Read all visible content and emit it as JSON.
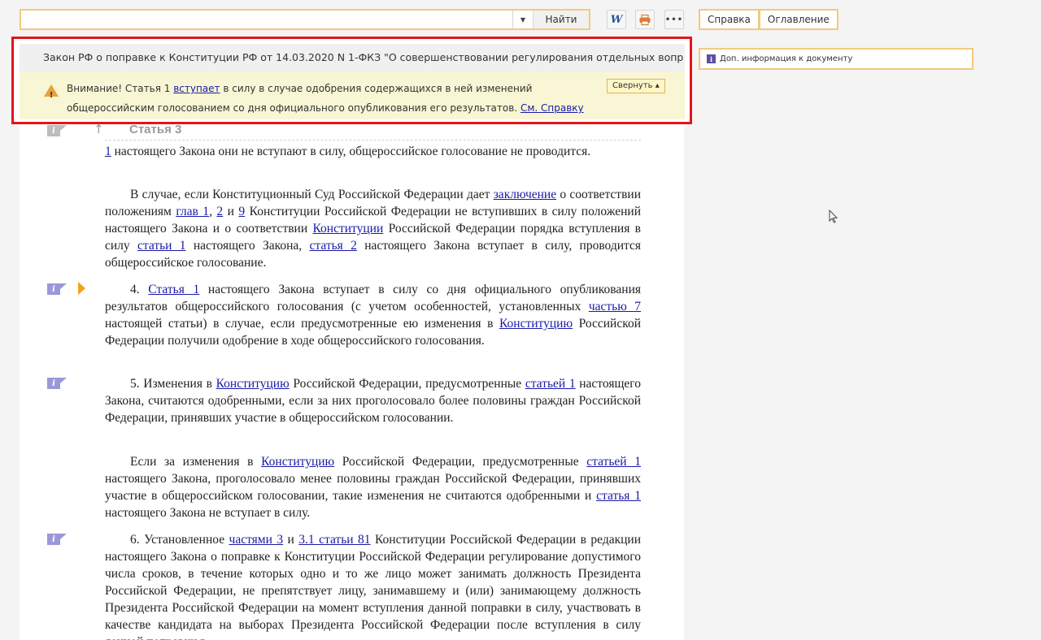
{
  "toolbar": {
    "search_value": "",
    "search_button": "Найти",
    "word_icon_glyph": "W",
    "more_glyph": "•••"
  },
  "right_panel": {
    "tabs": [
      "Справка",
      "Оглавление"
    ],
    "doc_info_icon": "i",
    "doc_info_label": "Доп. информация к документу"
  },
  "banner": {
    "title": "Закон РФ о поправке к Конституции РФ от 14.03.2020 N 1-ФКЗ \"О совершенствовании регулирования отдельных вопр",
    "warning_prefix": "Внимание! Статья 1 ",
    "warning_link": "вступает",
    "warning_mid": " в силу в случае одобрения содержащихся в ней изменений",
    "warning_line2": "общероссийским голосованием со дня официального опубликования его результатов. ",
    "warning_link2": "См. Справку",
    "collapse_label": "Свернуть ▴"
  },
  "article": {
    "heading": "Статья 3",
    "up_arrow": "↑",
    "margin_icon": "i",
    "p0": {
      "link": "1",
      "text": " настоящего Закона они не вступают в силу, общероссийское голосование не проводится."
    },
    "p1": {
      "t1": "В случае, если Конституционный Суд Российской Федерации дает ",
      "l1": "заключение",
      "t2": " о соответствии положениям ",
      "l2": "глав 1",
      "t3": ", ",
      "l3": "2",
      "t4": " и ",
      "l4": "9",
      "t5": " Конституции Российской Федерации не вступивших в силу положений настоящего Закона и о соответствии ",
      "l5": "Конституции",
      "t6": " Российской Федерации порядка вступления в силу ",
      "l6": "статьи 1",
      "t7": " настоящего Закона, ",
      "l7": "статья 2",
      "t8": " настоящего Закона вступает в силу, проводится общероссийское голосование."
    },
    "p2": {
      "t1": "4. ",
      "l1": "Статья 1",
      "t2": " настоящего Закона вступает в силу со дня официального опубликования результатов общероссийского голосования (с учетом особенностей, установленных ",
      "l2": "частью 7",
      "t3": " настоящей статьи) в случае, если предусмотренные ею изменения в ",
      "l3": "Конституцию",
      "t4": " Российской Федерации получили одобрение в ходе общероссийского голосования."
    },
    "p3": {
      "t1": "5. Изменения в ",
      "l1": "Конституцию",
      "t2": " Российской Федерации, предусмотренные ",
      "l2": "статьей 1",
      "t3": " настоящего Закона, считаются одобренными, если за них проголосовало более половины граждан Российской Федерации, принявших участие в общероссийском голосовании."
    },
    "p4": {
      "t1": "Если за изменения в ",
      "l1": "Конституцию",
      "t2": " Российской Федерации, предусмотренные ",
      "l2": "статьей 1",
      "t3": " настоящего Закона, проголосовало менее половины граждан Российской Федерации, принявших участие в общероссийском голосовании, такие изменения не считаются одобренными и ",
      "l3": "статья 1",
      "t4": " настоящего Закона не вступает в силу."
    },
    "p5": {
      "t1": "6. Установленное ",
      "l1": "частями 3",
      "t2": " и ",
      "l2": "3.1 статьи 81",
      "t3": " Конституции Российской Федерации в редакции настоящего Закона о поправке к Конституции Российской Федерации регулирование допустимого числа сроков, в течение которых одно и то же лицо может занимать должность Президента Российской Федерации, не препятствует лицу, занимавшему и (или) занимающему должность Президента Российской Федерации на момент вступления данной поправки в силу, участвовать в качестве кандидата на выборах Президента Российской Федерации после вступления в силу данной поправки в"
    }
  }
}
